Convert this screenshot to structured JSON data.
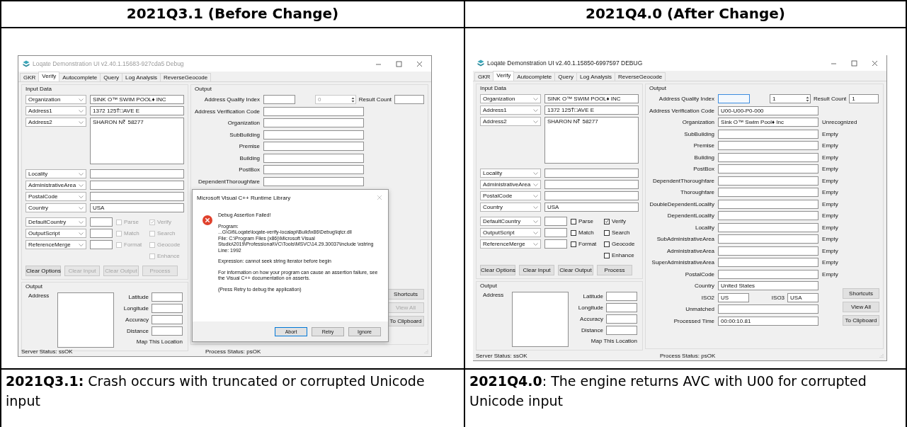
{
  "headers": [
    "2021Q3.1 (Before Change)",
    "2021Q4.0 (After Change)"
  ],
  "windows": [
    {
      "title": "Loqate Demonstration UI v2.40.1.15683-927cda5 Debug",
      "active": false,
      "tabs": [
        {
          "label": "GKR",
          "selected": false
        },
        {
          "label": "Verify",
          "selected": true
        },
        {
          "label": "Autocomplete",
          "selected": false
        },
        {
          "label": "Query",
          "selected": false
        },
        {
          "label": "Log Analysis",
          "selected": false
        },
        {
          "label": "ReverseGeocode",
          "selected": false
        }
      ],
      "input": {
        "legend": "Input Data",
        "fields": [
          {
            "label": "Organization",
            "value": "SINK O™ SWIM POOL♦ INC",
            "multiline": false
          },
          {
            "label": "Address1",
            "value": "1372 125T̂□AVE E",
            "multiline": false
          },
          {
            "label": "Address2",
            "value": "SHARON N₹ 58277",
            "multiline": true
          },
          {
            "label": "Locality",
            "multiline": false
          },
          {
            "label": "AdministrativeArea",
            "multiline": false
          },
          {
            "label": "PostalCode",
            "multiline": false
          },
          {
            "label": "Country",
            "value": "USA",
            "multiline": false
          }
        ],
        "options": [
          "DefaultCountry",
          "OutputScript",
          "ReferenceMerge"
        ],
        "check_columns": [
          [
            {
              "label": "Parse",
              "checked": false,
              "disabled": true
            },
            {
              "label": "Match",
              "checked": false,
              "disabled": true
            },
            {
              "label": "Format",
              "checked": false,
              "disabled": true
            }
          ],
          [
            {
              "label": "Verify",
              "checked": true,
              "disabled": true
            },
            {
              "label": "Search",
              "checked": false,
              "disabled": true
            },
            {
              "label": "Geocode",
              "checked": false,
              "disabled": true
            },
            {
              "label": "Enhance",
              "checked": false,
              "disabled": true
            }
          ]
        ],
        "buttons": [
          {
            "label": "Clear Options",
            "disabled": false
          },
          {
            "label": "Clear Input",
            "disabled": true
          },
          {
            "label": "Clear Output",
            "disabled": true
          },
          {
            "label": "Process",
            "disabled": true
          }
        ]
      },
      "map": {
        "legend": "Output",
        "address_label": "Address",
        "coords": [
          "Latitude",
          "Longitude",
          "Accuracy",
          "Distance"
        ],
        "link": "Map This Location"
      },
      "output": {
        "legend": "Output",
        "quality": {
          "label": "Address Quality Index",
          "focused": false
        },
        "spinner": {
          "value": "0",
          "disabled": true
        },
        "result_count": {
          "label": "Result Count"
        },
        "rows": [
          {
            "kind": "field",
            "label": "Address Verification Code"
          },
          {
            "kind": "field",
            "label": "Organization"
          },
          {
            "kind": "field",
            "label": "SubBuilding"
          },
          {
            "kind": "field",
            "label": "Premise"
          },
          {
            "kind": "field",
            "label": "Building"
          },
          {
            "kind": "field",
            "label": "PostBox"
          },
          {
            "kind": "field",
            "label": "DependentThoroughfare"
          }
        ],
        "buttons": [
          {
            "label": "Shortcuts",
            "disabled": false
          },
          {
            "label": "View All",
            "disabled": true
          },
          {
            "label": "To Clipboard",
            "disabled": false
          }
        ]
      },
      "status": {
        "server": "Server Status: ssOK",
        "process": "Process Status: psOK"
      },
      "dialog": {
        "title": "Microsoft Visual C++ Runtime Library",
        "paragraphs": [
          [
            "Debug Assertion Failed!"
          ],
          [
            "Program:",
            "...G\\Git\\Loqate\\loqate-verify-localapi\\Build\\x86\\Debug\\lqtcr.dll",
            "File: C:\\Program Files (x86)\\Microsoft Visual Studio\\2019\\Professional\\VC\\Tools\\MSVC\\14.29.30037\\include \\xstring",
            "Line: 1992"
          ],
          [
            "Expression: cannot seek string iterator before begin"
          ],
          [
            "For information on how your program can cause an assertion failure, see the Visual C++ documentation on asserts."
          ],
          [
            "(Press Retry to debug the application)"
          ]
        ],
        "buttons": [
          {
            "label": "Abort",
            "selected": true
          },
          {
            "label": "Retry",
            "selected": false
          },
          {
            "label": "Ignore",
            "selected": false
          }
        ]
      }
    },
    {
      "title": "Loqate Demonstration UI v2.40.1.15850-6997597  DEBUG",
      "active": true,
      "tabs": [
        {
          "label": "GKR",
          "selected": false
        },
        {
          "label": "Verify",
          "selected": true
        },
        {
          "label": "Autocomplete",
          "selected": false
        },
        {
          "label": "Query",
          "selected": false
        },
        {
          "label": "Log Analysis",
          "selected": false
        },
        {
          "label": "ReverseGeocode",
          "selected": false
        }
      ],
      "input": {
        "legend": "Input Data",
        "fields": [
          {
            "label": "Organization",
            "value": "SINK O™ SWIM POOL♦ INC",
            "multiline": false
          },
          {
            "label": "Address1",
            "value": "1372 125T̂□AVE E",
            "multiline": false
          },
          {
            "label": "Address2",
            "value": "SHARON N₹ 58277",
            "multiline": true
          },
          {
            "label": "Locality",
            "multiline": false
          },
          {
            "label": "AdministrativeArea",
            "multiline": false
          },
          {
            "label": "PostalCode",
            "multiline": false
          },
          {
            "label": "Country",
            "value": "USA",
            "multiline": false
          }
        ],
        "options": [
          "DefaultCountry",
          "OutputScript",
          "ReferenceMerge"
        ],
        "check_columns": [
          [
            {
              "label": "Parse",
              "checked": false,
              "disabled": false
            },
            {
              "label": "Match",
              "checked": false,
              "disabled": false
            },
            {
              "label": "Format",
              "checked": false,
              "disabled": false
            }
          ],
          [
            {
              "label": "Verify",
              "checked": true,
              "disabled": false
            },
            {
              "label": "Search",
              "checked": false,
              "disabled": false
            },
            {
              "label": "Geocode",
              "checked": false,
              "disabled": false
            },
            {
              "label": "Enhance",
              "checked": false,
              "disabled": false
            }
          ]
        ],
        "buttons": [
          {
            "label": "Clear Options",
            "disabled": false
          },
          {
            "label": "Clear Input",
            "disabled": false
          },
          {
            "label": "Clear Output",
            "disabled": false
          },
          {
            "label": "Process",
            "disabled": false
          }
        ]
      },
      "map": {
        "legend": "Output",
        "address_label": "Address",
        "coords": [
          "Latitude",
          "Longitude",
          "Accuracy",
          "Distance"
        ],
        "link": "Map This Location"
      },
      "output": {
        "legend": "Output",
        "quality": {
          "label": "Address Quality Index",
          "focused": true
        },
        "spinner": {
          "value": "1",
          "disabled": false
        },
        "result_count": {
          "label": "Result Count",
          "value": "1"
        },
        "rows": [
          {
            "kind": "field",
            "label": "Address Verification Code",
            "value": "U00-U00-P0-000"
          },
          {
            "kind": "field",
            "label": "Organization",
            "value": "Sink O™ Swim Pool♦ Inc",
            "status": "Unrecognized"
          },
          {
            "kind": "field",
            "label": "SubBuilding",
            "status": "Empty"
          },
          {
            "kind": "field",
            "label": "Premise",
            "status": "Empty"
          },
          {
            "kind": "field",
            "label": "Building",
            "status": "Empty"
          },
          {
            "kind": "field",
            "label": "PostBox",
            "status": "Empty"
          },
          {
            "kind": "field",
            "label": "DependentThoroughfare",
            "status": "Empty"
          },
          {
            "kind": "field",
            "label": "Thoroughfare",
            "status": "Empty"
          },
          {
            "kind": "field",
            "label": "DoubleDependentLocality",
            "status": "Empty"
          },
          {
            "kind": "field",
            "label": "DependentLocality",
            "status": "Empty"
          },
          {
            "kind": "field",
            "label": "Locality",
            "status": "Empty"
          },
          {
            "kind": "field",
            "label": "SubAdministrativeArea",
            "status": "Empty"
          },
          {
            "kind": "field",
            "label": "AdministrativeArea",
            "status": "Empty"
          },
          {
            "kind": "field",
            "label": "SuperAdministrativeArea",
            "status": "Empty"
          },
          {
            "kind": "field",
            "label": "PostalCode",
            "status": "Empty"
          },
          {
            "kind": "field",
            "label": "Country",
            "value": "United States"
          },
          {
            "kind": "pair",
            "label": "ISO2",
            "value": "US",
            "label2": "ISO3",
            "value2": "USA"
          },
          {
            "kind": "field",
            "label": "Unmatched"
          },
          {
            "kind": "field",
            "label": "Processed Time",
            "value": "00:00:10.81"
          }
        ],
        "buttons": [
          {
            "label": "Shortcuts",
            "disabled": false
          },
          {
            "label": "View All",
            "disabled": false
          },
          {
            "label": "To Clipboard",
            "disabled": false
          }
        ]
      },
      "status": {
        "server": "Server Status: ssOK",
        "process": "Process Status: psOK"
      }
    }
  ],
  "captions": [
    "**2021Q3.1:** Crash occurs with truncated or corrupted Unicode input",
    "**2021Q4.0**: The engine returns AVC with U00 for corrupted Unicode input"
  ]
}
